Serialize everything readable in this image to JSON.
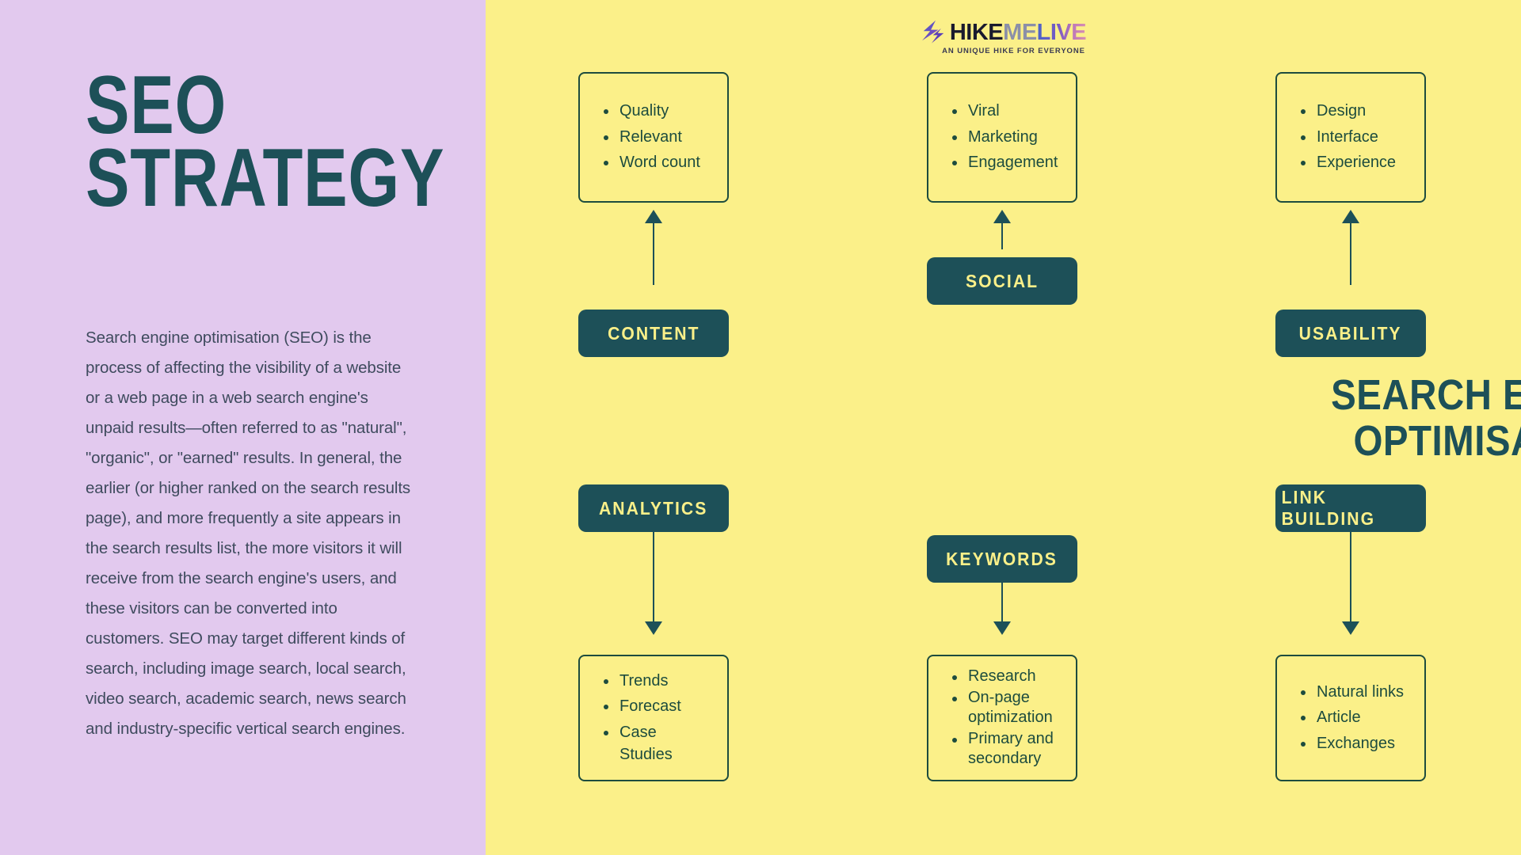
{
  "colors": {
    "left_panel_bg": "#e2c9ee",
    "right_panel_bg": "#fbf089",
    "dark_teal": "#1d5058",
    "box_border": "#1d4c3e",
    "body_text": "#3f4b5e"
  },
  "left": {
    "title_line1": "SEO",
    "title_line2": "STRATEGY",
    "paragraph": "Search engine optimisation (SEO) is the process of affecting the visibility of a website or a web page in a web search engine's unpaid results—often referred to as \"natural\", \"organic\", or \"earned\" results. In general, the earlier (or higher ranked on the search results page), and more frequently a site appears in the search results list, the more visitors it will receive from the search engine's users, and these visitors can be converted into customers. SEO may target different kinds of search, including image search, local search, video search, academic search, news search and industry-specific vertical search engines."
  },
  "logo": {
    "mark": "lightning-bolt-icon",
    "word_part1": "HIKE",
    "word_part2": "ME",
    "word_part3": "LIVE",
    "tagline": "AN UNIQUE HIKE FOR EVERYONE"
  },
  "center_headline": {
    "line1": "SEARCH ENGINE",
    "line2": "OPTIMISATION"
  },
  "units": [
    {
      "id": "content",
      "pill_label": "CONTENT",
      "arrow": "up",
      "items": [
        "Quality",
        "Relevant",
        "Word count"
      ]
    },
    {
      "id": "social",
      "pill_label": "SOCIAL",
      "arrow": "up",
      "items": [
        "Viral",
        "Marketing",
        "Engagement"
      ]
    },
    {
      "id": "usability",
      "pill_label": "USABILITY",
      "arrow": "up",
      "items": [
        "Design",
        "Interface",
        "Experience"
      ]
    },
    {
      "id": "analytics",
      "pill_label": "ANALYTICS",
      "arrow": "down",
      "items": [
        "Trends",
        "Forecast",
        "Case Studies"
      ]
    },
    {
      "id": "keywords",
      "pill_label": "KEYWORDS",
      "arrow": "down",
      "items": [
        "Research",
        "On-page optimization",
        "Primary and secondary"
      ]
    },
    {
      "id": "link_building",
      "pill_label": "LINK BUILDING",
      "arrow": "down",
      "items": [
        "Natural links",
        "Article",
        "Exchanges"
      ]
    }
  ]
}
